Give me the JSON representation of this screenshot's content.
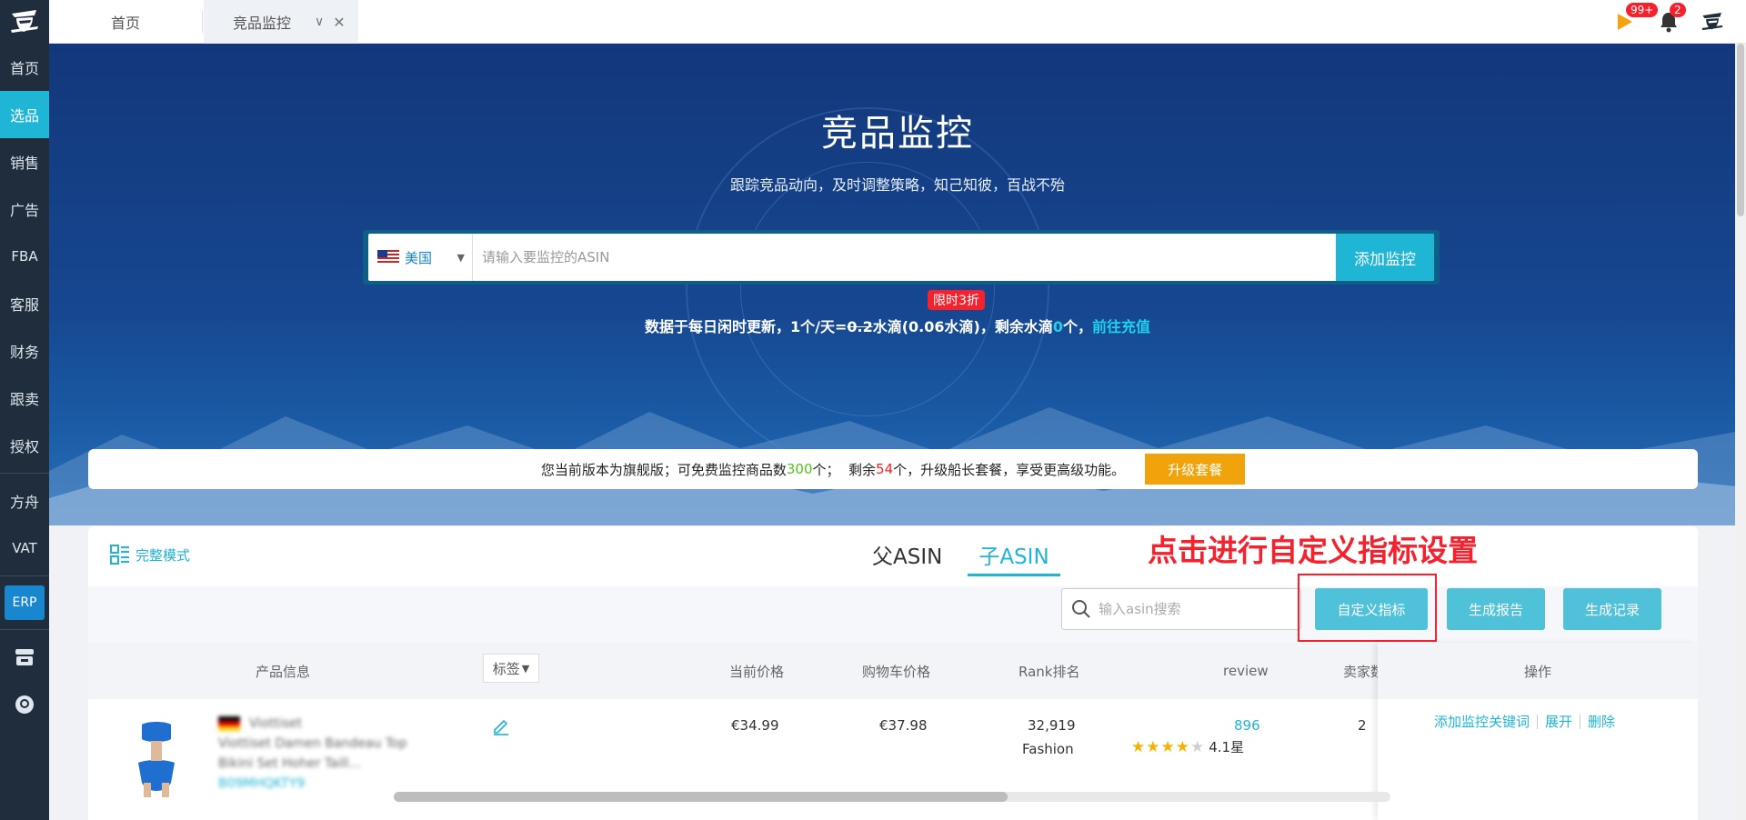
{
  "sidebar": {
    "items": [
      {
        "label": "首页"
      },
      {
        "label": "选品",
        "active": true
      },
      {
        "label": "销售"
      },
      {
        "label": "广告"
      },
      {
        "label": "FBA"
      },
      {
        "label": "客服"
      },
      {
        "label": "财务"
      },
      {
        "label": "跟卖"
      },
      {
        "label": "授权"
      },
      {
        "label": "方舟"
      },
      {
        "label": "VAT"
      }
    ],
    "erp_label": "ERP"
  },
  "topbar": {
    "tabs": [
      {
        "label": "首页"
      },
      {
        "label": "竞品监控",
        "active": true
      }
    ],
    "flag_badge": "99+",
    "bell_badge": "2"
  },
  "hero": {
    "title": "竞品监控",
    "subtitle": "跟踪竞品动向，及时调整策略，知己知彼，百战不殆",
    "country": "美国",
    "asin_placeholder": "请输入要监控的ASIN",
    "add_button": "添加监控",
    "discount_tag": "限时3折",
    "info_prefix": "数据于每日闲时更新，1个/天=",
    "info_old_price": "0.2",
    "info_mid": "水滴(0.06水滴)，剩余水滴",
    "info_remaining": "0",
    "info_suffix": "个，",
    "recharge_link": "前往充值"
  },
  "notice": {
    "text_before": "您当前版本为旗舰版；可免费监控商品数",
    "free_count": "300",
    "text_mid": "个；  剩余",
    "remaining_count": "54",
    "text_after": "个，升级船长套餐，享受更高级功能。",
    "upgrade_button": "升级套餐"
  },
  "panel": {
    "mode_label": "完整模式",
    "tabs": [
      {
        "label": "父ASIN"
      },
      {
        "label": "子ASIN",
        "active": true
      }
    ],
    "annotation": "点击进行自定义指标设置",
    "search_placeholder": "输入asin搜索",
    "buttons": {
      "custom_metrics": "自定义指标",
      "generate_report": "生成报告",
      "generate_records": "生成记录"
    },
    "columns": {
      "product_info": "产品信息",
      "tag": "标签",
      "current_price": "当前价格",
      "cart_price": "购物车价格",
      "rank": "Rank排名",
      "review": "review",
      "seller": "卖家数",
      "actions": "操作"
    },
    "row": {
      "brand_blurred": "Viottiset",
      "title_blurred_1": "Viottiset Damen Bandeau Top",
      "title_blurred_2": "Bikini Set Hoher Taill...",
      "asin_blurred": "B09MHQKTY9",
      "current_price": "€34.99",
      "cart_price": "€37.98",
      "rank": "32,919",
      "rank_category": "Fashion",
      "review_count": "896",
      "rating": 4.1,
      "rating_label": "4.1星",
      "seller_partial": "2"
    },
    "actions": {
      "add_keyword": "添加监控关键词",
      "expand": "展开",
      "delete": "删除"
    }
  }
}
